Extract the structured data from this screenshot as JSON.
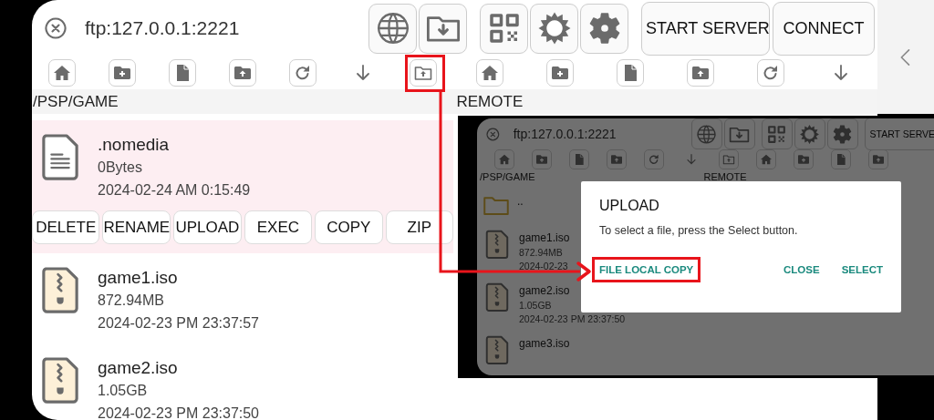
{
  "header": {
    "address": "ftp:127.0.0.1:2221",
    "buttons": [
      "START SERVER",
      "CONNECT"
    ]
  },
  "local_path": "/PSP/GAME",
  "remote_label": "REMOTE",
  "local_files": [
    {
      "name": ".nomedia",
      "size": "0Bytes",
      "date": "2024-02-24 AM 0:15:49",
      "kind": "document",
      "selected": true
    },
    {
      "name": "game1.iso",
      "size": "872.94MB",
      "date": "2024-02-23 PM 23:37:57",
      "kind": "archive",
      "selected": false
    },
    {
      "name": "game2.iso",
      "size": "1.05GB",
      "date": "2024-02-23 PM 23:37:50",
      "kind": "archive",
      "selected": false
    }
  ],
  "file_actions": [
    "DELETE",
    "RENAME",
    "UPLOAD",
    "EXEC",
    "COPY",
    "ZIP"
  ],
  "inset": {
    "address": "ftp:127.0.0.1:2221",
    "button": "START SERVE",
    "local_path": "/PSP/GAME",
    "remote_label": "REMOTE",
    "files": [
      {
        "name": "..",
        "kind": "folder"
      },
      {
        "name": "game1.iso",
        "size": "872.94MB",
        "date": "2024-02-23",
        "kind": "archive"
      },
      {
        "name": "game2.iso",
        "size": "1.05GB",
        "date": "2024-02-23 PM 23:37:50",
        "kind": "archive"
      },
      {
        "name": "game3.iso",
        "kind": "archive"
      }
    ],
    "dialog": {
      "title": "UPLOAD",
      "message": "To select a file, press the Select button.",
      "actions": [
        {
          "label": "FILE LOCAL COPY",
          "highlighted": true
        },
        {
          "label": "CLOSE",
          "highlighted": false
        },
        {
          "label": "SELECT",
          "highlighted": false
        }
      ]
    }
  }
}
